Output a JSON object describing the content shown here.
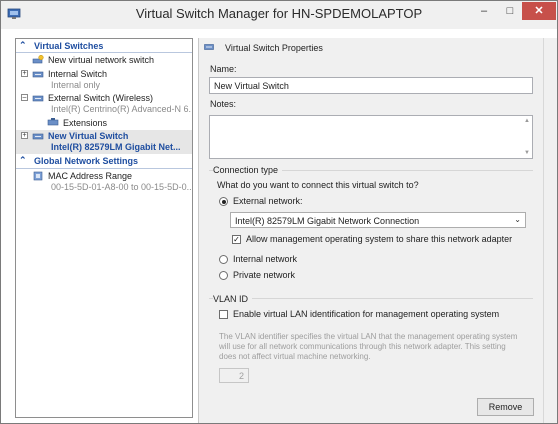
{
  "window": {
    "title": "Virtual Switch Manager for HN-SPDEMOLAPTOP",
    "minimize_glyph": "–",
    "maximize_glyph": "□",
    "close_glyph": "✕"
  },
  "tree": {
    "virtual_switches_header": "Virtual Switches",
    "new_switch": "New virtual network switch",
    "internal_switch": {
      "name": "Internal Switch",
      "detail": "Internal only"
    },
    "external_wireless": {
      "name": "External Switch (Wireless)",
      "detail": "Intel(R) Centrino(R) Advanced-N 6...",
      "child": "Extensions"
    },
    "new_virtual_switch": {
      "name": "New Virtual Switch",
      "detail": "Intel(R) 82579LM Gigabit Net..."
    },
    "global_settings_header": "Global Network Settings",
    "mac_range": {
      "name": "MAC Address Range",
      "detail": "00-15-5D-01-A8-00 to 00-15-5D-0..."
    }
  },
  "props": {
    "header": "Virtual Switch Properties",
    "name_label": "Name:",
    "name_value": "New Virtual Switch",
    "notes_label": "Notes:",
    "connection_type_title": "Connection type",
    "connection_question": "What do you want to connect this virtual switch to?",
    "external_label": "External network:",
    "adapter_selected": "Intel(R) 82579LM Gigabit Network Connection",
    "allow_mgmt_label": "Allow management operating system to share this network adapter",
    "internal_label": "Internal network",
    "private_label": "Private network",
    "vlan_title": "VLAN ID",
    "vlan_enable_label": "Enable virtual LAN identification for management operating system",
    "vlan_help": "The VLAN identifier specifies the virtual LAN that the management operating system will use for all network communications through this network adapter. This setting does not affect virtual machine networking.",
    "vlan_value": "2",
    "remove_label": "Remove"
  },
  "state": {
    "selected_connection": "external",
    "allow_mgmt_checked": true,
    "vlan_enabled": false
  },
  "colors": {
    "accent_blue": "#1f4ea0",
    "selection_bg": "#e6e6e6",
    "pane_bg": "#f0f0f0"
  }
}
